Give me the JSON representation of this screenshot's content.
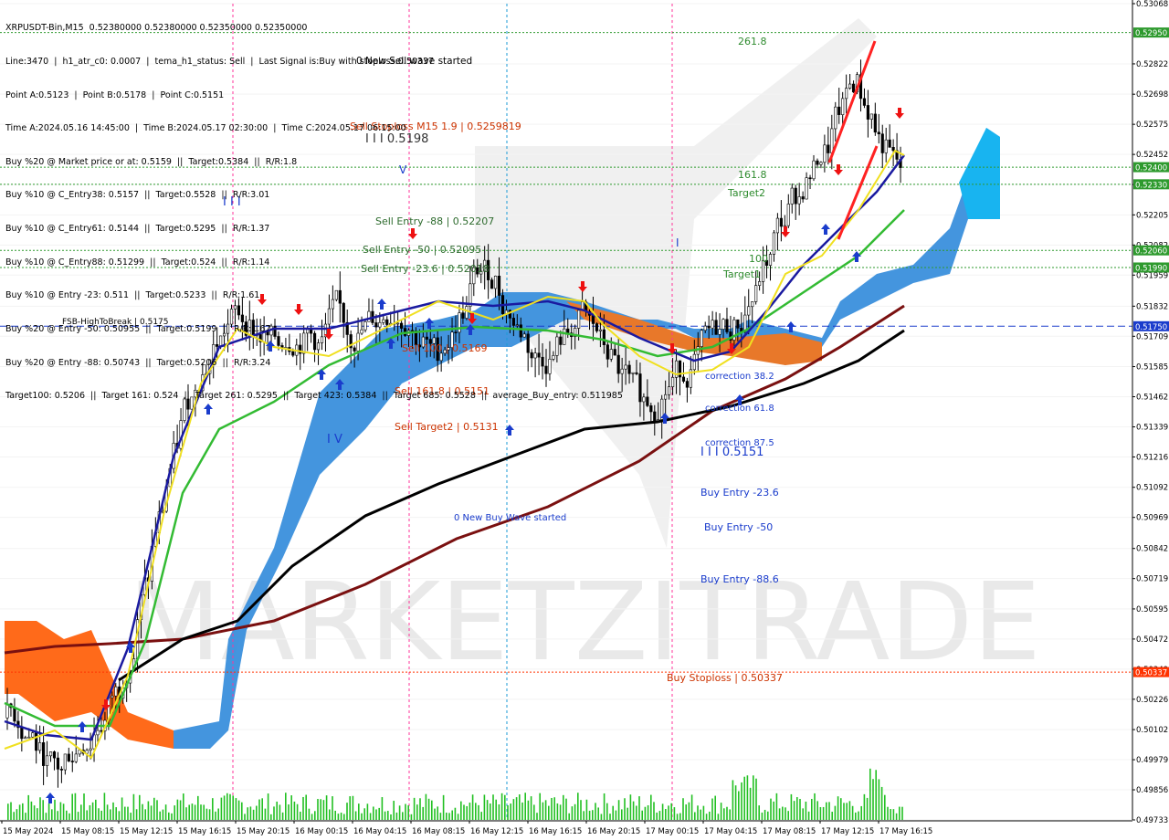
{
  "header": {
    "lines": [
      "XRPUSDT-Bin,M15  0.52380000 0.52380000 0.52350000 0.52350000",
      "Line:3470  |  h1_atr_c0: 0.0007  |  tema_h1_status: Sell  |  Last Signal is:Buy with stoploss:0.50337",
      "Point A:0.5123  |  Point B:0.5178  |  Point C:0.5151",
      "Time A:2024.05.16 14:45:00  |  Time B:2024.05.17 02:30:00  |  Time C:2024.05.17 06:15:00",
      "Buy %20 @ Market price or at: 0.5159  ||  Target:0.5384  ||  R/R:1.8",
      "Buy %10 @ C_Entry38: 0.5157  ||  Target:0.5528  ||  R/R:3.01",
      "Buy %10 @ C_Entry61: 0.5144  ||  Target:0.5295  ||  R/R:1.37",
      "Buy %10 @ C_Entry88: 0.51299  ||  Target:0.524  ||  R/R:1.14",
      "Buy %10 @ Entry -23: 0.511  ||  Target:0.5233  ||  R/R:1.61",
      "Buy %20 @ Entry -50: 0.50955  ||  Target:0.5199  ||  R/R:1.67",
      "Buy %20 @ Entry -88: 0.50743  ||  Target:0.5206  ||  R/R:3.24",
      "Target100: 0.5206  ||  Target 161: 0.524  ||  Target 261: 0.5295  ||  Target 423: 0.5384  ||  Target 685: 0.5528  ||  average_Buy_entry: 0.511985"
    ]
  },
  "watermark": "MARKETZITRADE",
  "chart_data": {
    "type": "candlestick",
    "symbol": "XRPUSDT-Bin",
    "timeframe": "M15",
    "y_ticks": [
      "0.53068",
      "0.52822",
      "0.52698",
      "0.52575",
      "0.52452",
      "0.52329",
      "0.52205",
      "0.52082",
      "0.51959",
      "0.51832",
      "0.51709",
      "0.51585",
      "0.51462",
      "0.51339",
      "0.51216",
      "0.51092",
      "0.50969",
      "0.50842",
      "0.50719",
      "0.50595",
      "0.50472",
      "0.50349",
      "0.50226",
      "0.50102",
      "0.49979",
      "0.49856",
      "0.49733"
    ],
    "ylim": [
      0.49733,
      0.53068
    ],
    "x_ticks": [
      "15 May 2024",
      "15 May 08:15",
      "15 May 12:15",
      "15 May 16:15",
      "15 May 20:15",
      "16 May 00:15",
      "16 May 04:15",
      "16 May 08:15",
      "16 May 12:15",
      "16 May 16:15",
      "16 May 20:15",
      "17 May 00:15",
      "17 May 04:15",
      "17 May 08:15",
      "17 May 12:15",
      "17 May 16:15"
    ],
    "price_tags": [
      {
        "value": "0.52950",
        "color": "#2e9a2e"
      },
      {
        "value": "0.52400",
        "color": "#2e9a2e"
      },
      {
        "value": "0.52330",
        "color": "#2e9a2e"
      },
      {
        "value": "0.52060",
        "color": "#2e9a2e"
      },
      {
        "value": "0.51990",
        "color": "#2e9a2e"
      },
      {
        "value": "0.51750",
        "color": "#1a3ccc"
      },
      {
        "value": "0.50337",
        "color": "#ff3300"
      }
    ],
    "annotations": [
      {
        "text": "261.8",
        "color": "#2e8b2e"
      },
      {
        "text": "161.8",
        "color": "#2e8b2e"
      },
      {
        "text": "Target2",
        "color": "#2e8b2e"
      },
      {
        "text": "100",
        "color": "#2e8b2e"
      },
      {
        "text": "Target1",
        "color": "#2e8b2e"
      },
      {
        "text": "0 New Sell wave started",
        "color": "#000000"
      },
      {
        "text": "Sell Stoploss M15 1.9 | 0.5259819",
        "color": "#cc3300"
      },
      {
        "text": "I I I 0.5198",
        "color": "#333333"
      },
      {
        "text": "Sell Entry -88 | 0.52207",
        "color": "#2e6b2e"
      },
      {
        "text": "Sell Entry -50 | 0.52095",
        "color": "#2e6b2e"
      },
      {
        "text": "Sell Entry -23.6 | 0.52018",
        "color": "#2e6b2e"
      },
      {
        "text": "Sell 100 | 0.5169",
        "color": "#cc3300"
      },
      {
        "text": "Sell 161.8 | 0.5151",
        "color": "#cc3300"
      },
      {
        "text": "Sell Target2 | 0.5131",
        "color": "#cc3300"
      },
      {
        "text": "0 New Buy Wave started",
        "color": "#1a3ccc"
      },
      {
        "text": "FSB-HighToBreak  |  0.5175",
        "color": "#000000"
      },
      {
        "text": "correction 38.2",
        "color": "#1a3ccc"
      },
      {
        "text": "correction 61.8",
        "color": "#1a3ccc"
      },
      {
        "text": "correction 87.5",
        "color": "#1a3ccc"
      },
      {
        "text": "I I I 0.5151",
        "color": "#1a3ccc"
      },
      {
        "text": "Buy Entry -23.6",
        "color": "#1a3ccc"
      },
      {
        "text": "Buy Entry -50",
        "color": "#1a3ccc"
      },
      {
        "text": "Buy Entry -88.6",
        "color": "#1a3ccc"
      },
      {
        "text": "Buy Stoploss  |  0.50337",
        "color": "#cc3300"
      },
      {
        "text": "I I I",
        "color": "#1a3ccc"
      },
      {
        "text": "I V",
        "color": "#1a3ccc"
      },
      {
        "text": "V",
        "color": "#1a3ccc"
      },
      {
        "text": "I",
        "color": "#1a3ccc"
      }
    ],
    "levels": [
      {
        "value": 0.5295,
        "style": "dotted",
        "color": "#2e9a2e"
      },
      {
        "value": 0.524,
        "style": "dotted",
        "color": "#2e9a2e"
      },
      {
        "value": 0.5233,
        "style": "dotted",
        "color": "#2e9a2e"
      },
      {
        "value": 0.5206,
        "style": "dotted",
        "color": "#2e9a2e"
      },
      {
        "value": 0.5199,
        "style": "dotted",
        "color": "#2e9a2e"
      },
      {
        "value": 0.5175,
        "style": "dashed",
        "color": "#1a3ccc"
      },
      {
        "value": 0.50337,
        "style": "dotted",
        "color": "#ff3300"
      }
    ],
    "candles_close_path": [
      0.5015,
      0.5008,
      0.4995,
      0.499,
      0.5005,
      0.501,
      0.5018,
      0.5028,
      0.505,
      0.5075,
      0.5105,
      0.513,
      0.515,
      0.5165,
      0.5172,
      0.518,
      0.5178,
      0.517,
      0.5165,
      0.5175,
      0.5172,
      0.5168,
      0.518,
      0.517,
      0.5175,
      0.5178,
      0.5185,
      0.518,
      0.5168,
      0.516,
      0.5175,
      0.5185,
      0.52,
      0.5195,
      0.518,
      0.517,
      0.516,
      0.5165,
      0.5172,
      0.518,
      0.517,
      0.516,
      0.515,
      0.514,
      0.5145,
      0.5155,
      0.5158,
      0.5162,
      0.517,
      0.5175,
      0.5178,
      0.519,
      0.5205,
      0.522,
      0.523,
      0.524,
      0.525,
      0.5265,
      0.5278,
      0.526,
      0.5245,
      0.5235
    ]
  }
}
